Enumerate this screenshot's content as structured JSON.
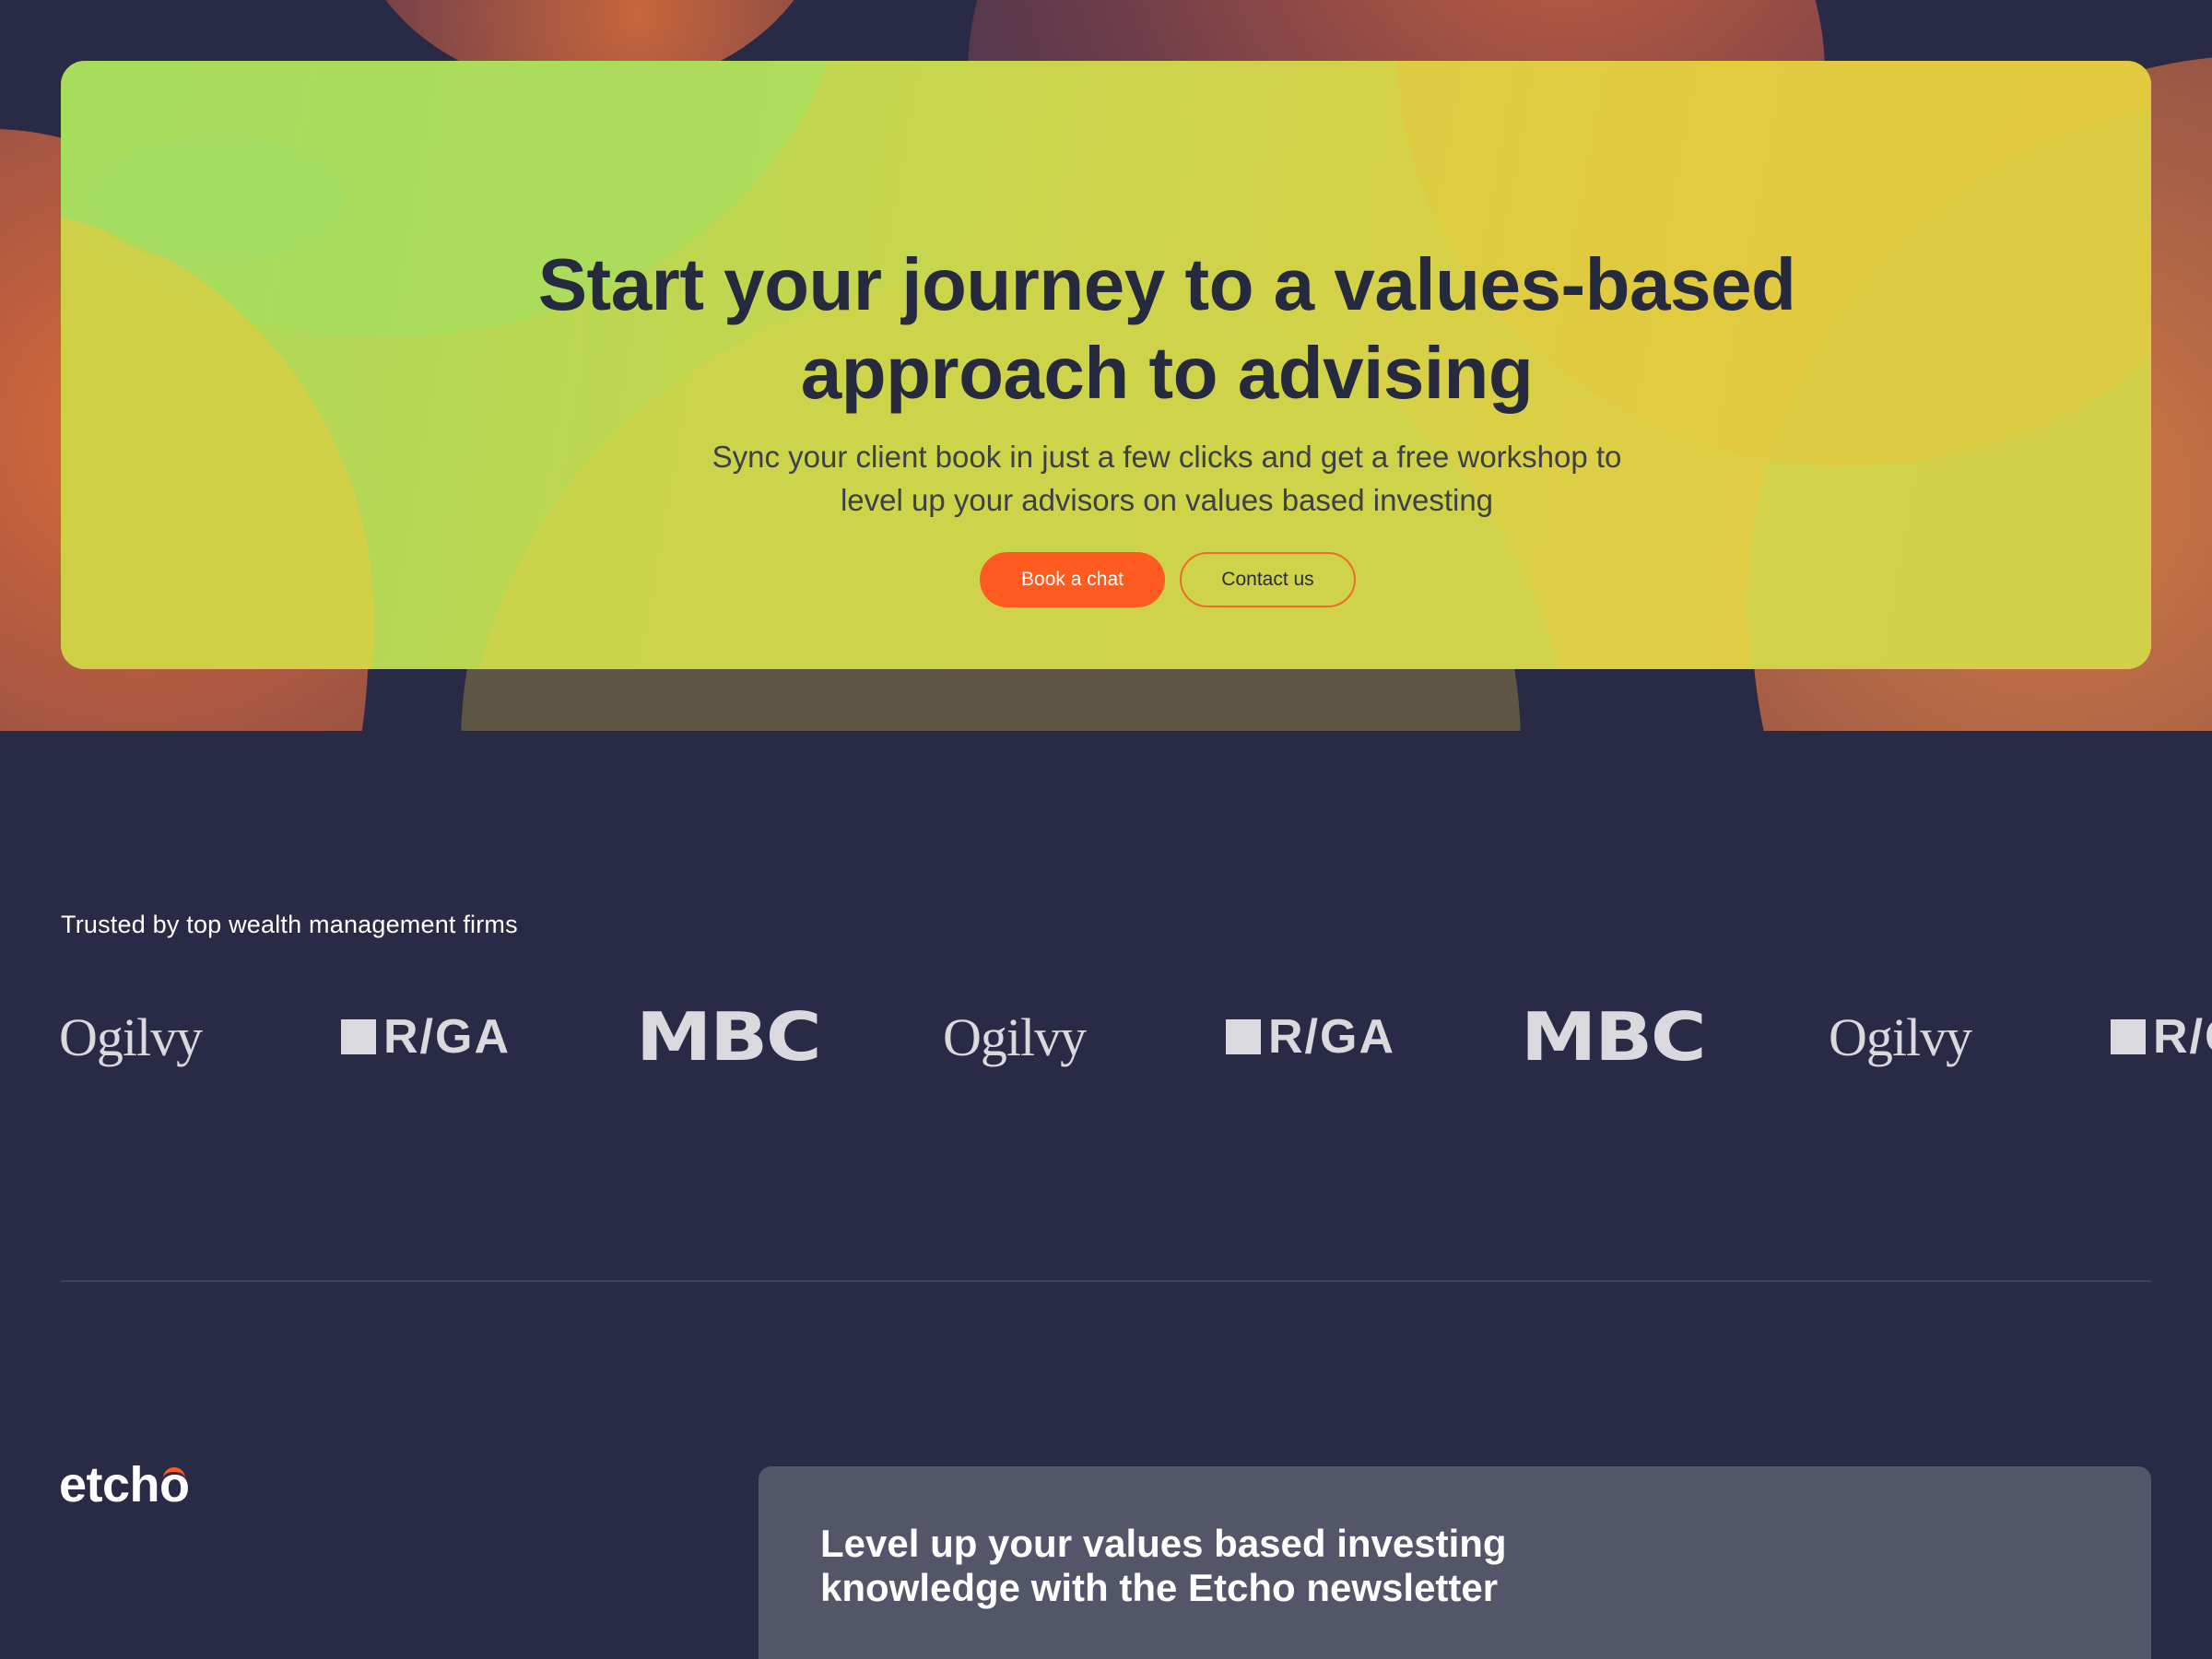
{
  "cta": {
    "title": "Start your journey to a values-based approach to advising",
    "subtitle": "Sync your client book in just a few clicks and get a free workshop to level up your advisors on values based investing",
    "primary_button": "Book a chat",
    "secondary_button": "Contact us"
  },
  "trusted": {
    "label": "Trusted by top wealth management firms",
    "logos": [
      "Ogilvy",
      "R/GA",
      "MBC",
      "Ogilvy",
      "R/GA",
      "MBC",
      "Ogilvy",
      "R/GA"
    ]
  },
  "footer": {
    "brand_prefix": "etch",
    "brand_suffix": "o",
    "newsletter_title": "Level up your values based investing knowledge with the Etcho newsletter"
  },
  "colors": {
    "background": "#292a45",
    "accent": "#ff5a1f",
    "card_gradient_start": "#a9d85a",
    "card_gradient_end": "#e3c93f",
    "newsletter_card": "#535569"
  }
}
